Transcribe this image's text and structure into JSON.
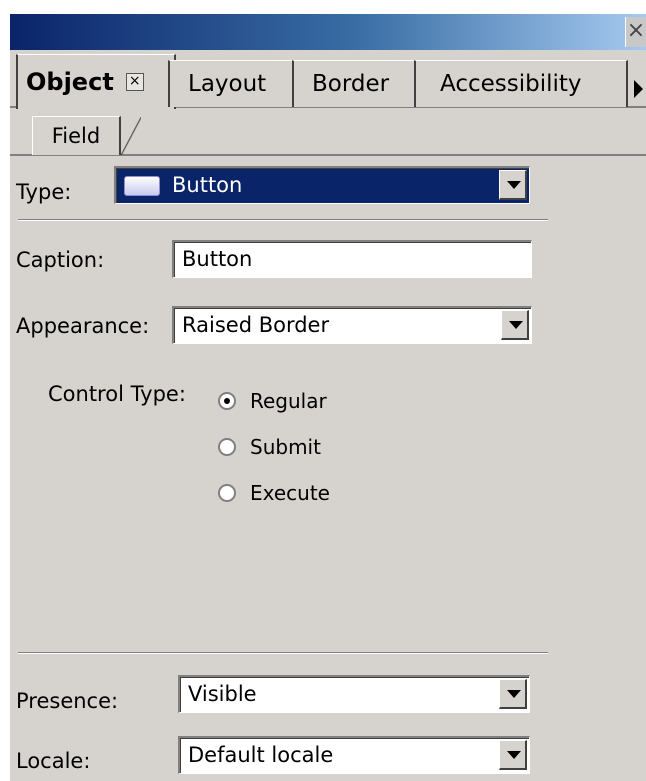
{
  "window": {
    "close_glyph": "×"
  },
  "tabs": [
    {
      "label": "Object"
    },
    {
      "label": "Layout"
    },
    {
      "label": "Border"
    },
    {
      "label": "Accessibility"
    }
  ],
  "tab_close_glyph": "×",
  "subtab": {
    "label": "Field"
  },
  "type": {
    "label": "Type:",
    "value": "Button",
    "icon": "button-swatch-icon"
  },
  "caption": {
    "label": "Caption:",
    "value": "Button"
  },
  "appearance": {
    "label": "Appearance:",
    "value": "Raised Border"
  },
  "control_type": {
    "label": "Control Type:",
    "options": [
      {
        "label": "Regular",
        "selected": true
      },
      {
        "label": "Submit",
        "selected": false
      },
      {
        "label": "Execute",
        "selected": false
      }
    ]
  },
  "presence": {
    "label": "Presence:",
    "value": "Visible"
  },
  "locale": {
    "label": "Locale:",
    "value": "Default locale"
  },
  "colors": {
    "panel": "#d6d3ce",
    "selection": "#0a246a",
    "title_start": "#0a246a",
    "title_end": "#a6caf0"
  }
}
